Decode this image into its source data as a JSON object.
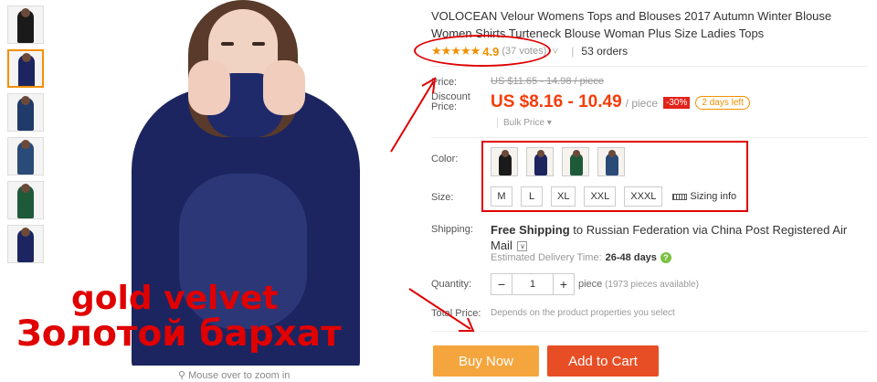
{
  "gallery": {
    "thumbnails": [
      {
        "color": "#1a1a1a"
      },
      {
        "color": "#1c2560"
      },
      {
        "color": "#203a6a"
      },
      {
        "color": "#2a4a78"
      },
      {
        "color": "#1e5a3a"
      },
      {
        "color": "#1c2560"
      }
    ],
    "overlay_line1": "gold velvet",
    "overlay_line2": "Золотой бархат",
    "zoom_hint": "Mouse over to zoom in"
  },
  "product": {
    "title": "VOLOCEAN Velour Womens Tops and Blouses 2017 Autumn Winter Blouse Women Shirts Turteneck Blouse Woman Plus Size Ladies Tops",
    "stars": "★★★★★",
    "rating": "4.9",
    "votes": "(37 votes)",
    "orders": "53 orders"
  },
  "price": {
    "label": "Price:",
    "original": "US $11.65 - 14.98 / piece",
    "discount_label_1": "Discount",
    "discount_label_2": "Price:",
    "discount_price": "US $8.16 - 10.49",
    "per_unit": "/ piece",
    "discount_badge": "-30%",
    "days_left": "2 days left",
    "bulk_price": "Bulk Price ▾"
  },
  "color": {
    "label": "Color:",
    "options": [
      {
        "color": "#1a1a1a"
      },
      {
        "color": "#1c2560"
      },
      {
        "color": "#1e5a3a"
      },
      {
        "color": "#2a4a78"
      }
    ]
  },
  "size": {
    "label": "Size:",
    "options": [
      "M",
      "L",
      "XL",
      "XXL",
      "XXXL"
    ],
    "sizing_info": "Sizing info"
  },
  "shipping": {
    "label": "Shipping:",
    "free_shipping": "Free Shipping",
    "to_text": " to Russian Federation via China Post Registered Air Mail",
    "delivery_label": "Estimated Delivery Time:",
    "delivery_days": "26-48 days",
    "help_icon": "?"
  },
  "quantity": {
    "label": "Quantity:",
    "minus": "−",
    "value": "1",
    "plus": "+",
    "unit": "piece",
    "available": "(1973 pieces available)"
  },
  "total": {
    "label": "Total Price:",
    "note": "Depends on the product properties you select"
  },
  "actions": {
    "buy_now": "Buy Now",
    "add_to_cart": "Add to Cart"
  },
  "annotation_color": "#e00000",
  "accent_orange": "#f29000",
  "price_red": "#f53d0a"
}
